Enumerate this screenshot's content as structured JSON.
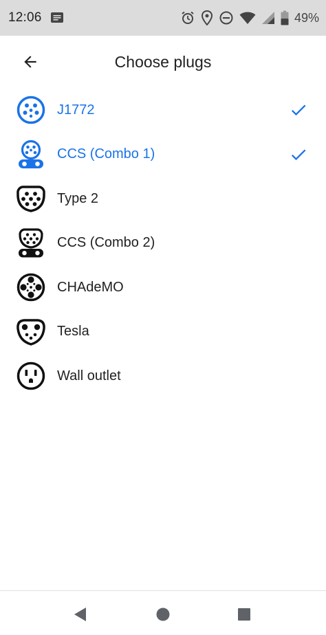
{
  "status_bar": {
    "time": "12:06",
    "battery_percent": "49%",
    "icons": [
      "message-icon",
      "alarm-icon",
      "location-icon",
      "do-not-disturb-icon",
      "wifi-icon",
      "signal-icon",
      "battery-icon"
    ]
  },
  "app_bar": {
    "title": "Choose plugs",
    "back_icon": "arrow-back-icon"
  },
  "colors": {
    "accent": "#1a73e8",
    "text": "#202124",
    "status_bar_bg": "#dcdcdc"
  },
  "plugs": [
    {
      "label": "J1772",
      "icon": "j1772-plug-icon",
      "selected": true
    },
    {
      "label": "CCS (Combo 1)",
      "icon": "ccs-combo1-plug-icon",
      "selected": true
    },
    {
      "label": "Type 2",
      "icon": "type2-plug-icon",
      "selected": false
    },
    {
      "label": "CCS (Combo 2)",
      "icon": "ccs-combo2-plug-icon",
      "selected": false
    },
    {
      "label": "CHAdeMO",
      "icon": "chademo-plug-icon",
      "selected": false
    },
    {
      "label": "Tesla",
      "icon": "tesla-plug-icon",
      "selected": false
    },
    {
      "label": "Wall outlet",
      "icon": "wall-outlet-icon",
      "selected": false
    }
  ],
  "nav_bar": {
    "buttons": [
      "back-triangle-icon",
      "home-circle-icon",
      "recents-square-icon"
    ]
  }
}
